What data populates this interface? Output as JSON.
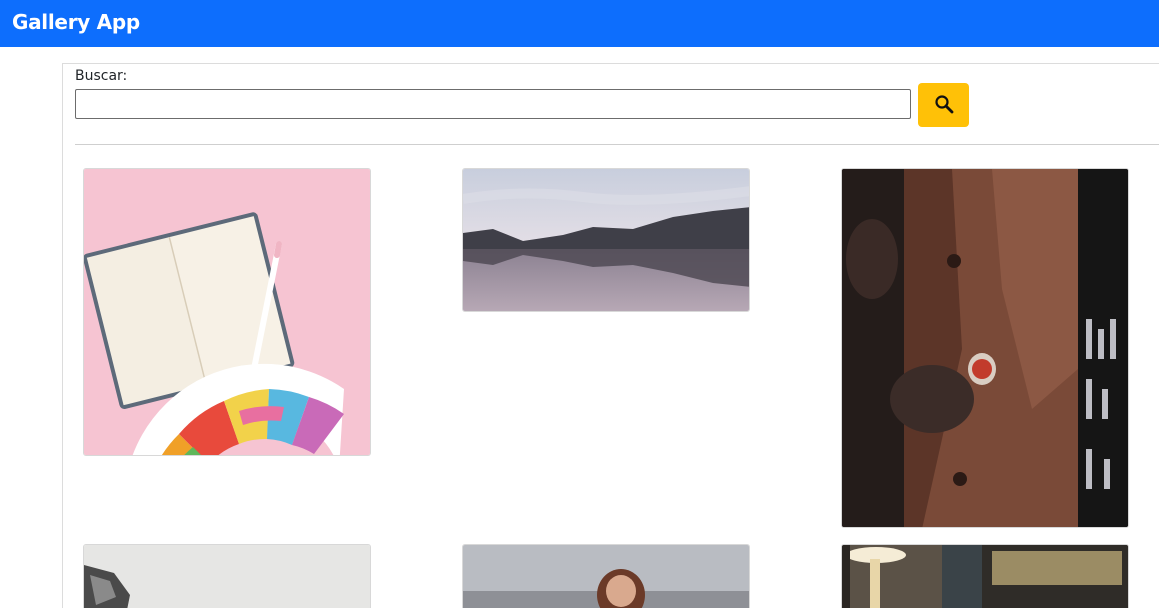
{
  "app": {
    "title": "Gallery App"
  },
  "search": {
    "label": "Buscar:",
    "value": "",
    "placeholder": ""
  },
  "colors": {
    "navbar": "#0d6efd",
    "search_button": "#ffc107"
  },
  "icons": {
    "search_button": "search-icon"
  },
  "gallery": {
    "images": [
      {
        "subject": "notebook-and-color-swatches"
      },
      {
        "subject": "lake-mountain-reflection"
      },
      {
        "subject": "man-in-coat-with-watch"
      },
      {
        "subject": "gray-photo-partial"
      },
      {
        "subject": "woman-by-sea-partial"
      },
      {
        "subject": "interior-lamp-partial"
      }
    ]
  }
}
